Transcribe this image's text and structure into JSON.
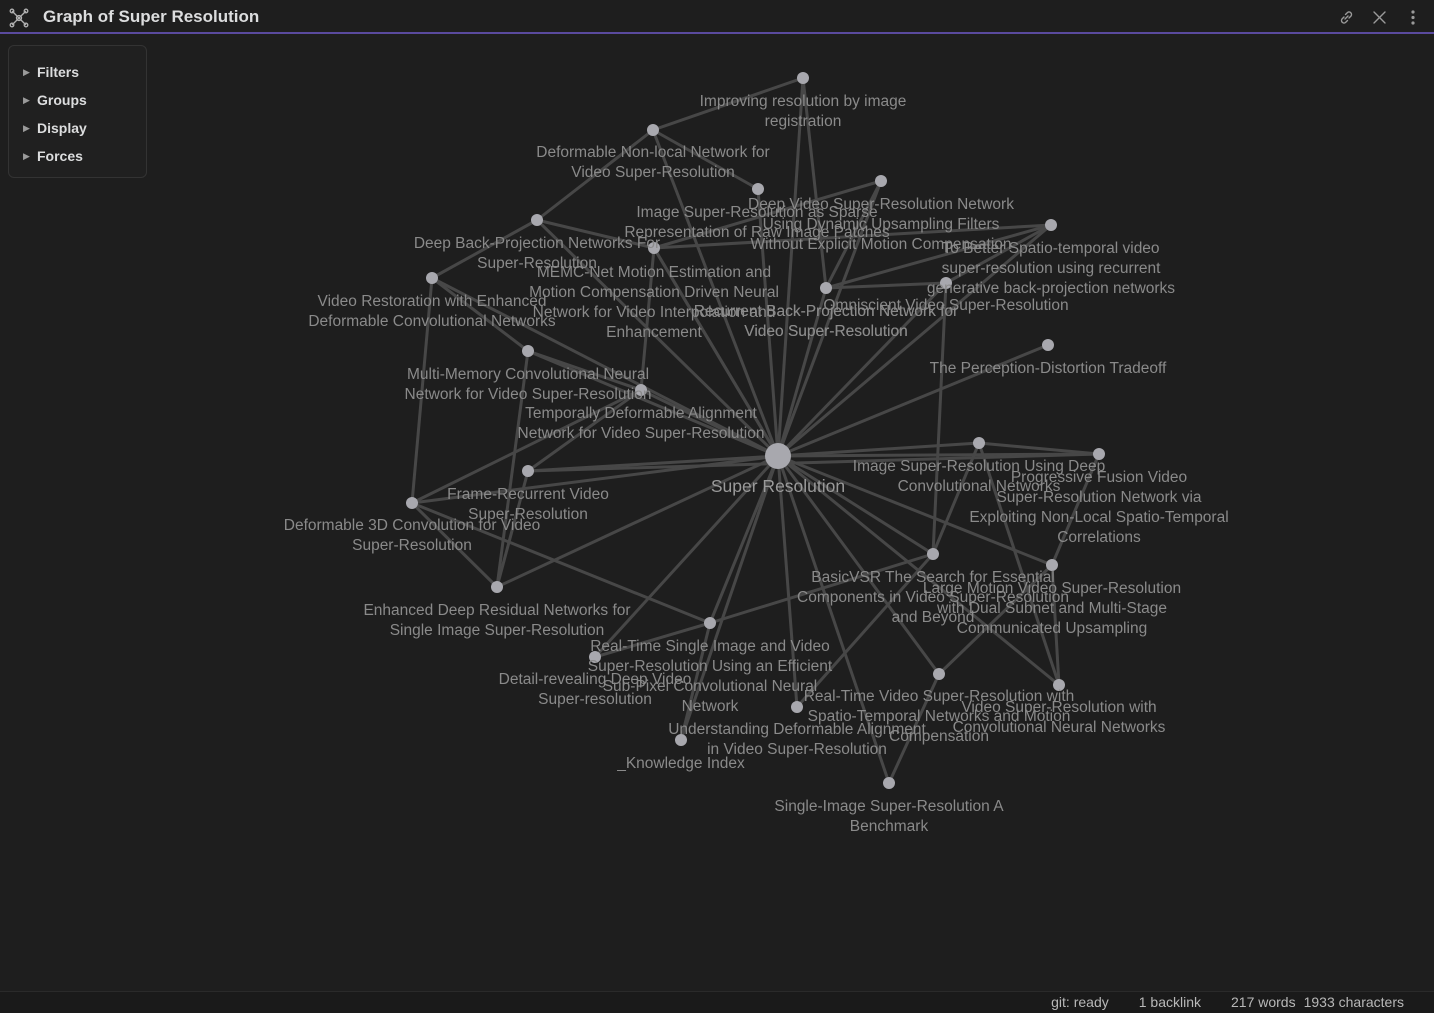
{
  "window": {
    "title": "Graph of Super Resolution",
    "icon": "graph-icon",
    "actions": [
      "link-icon",
      "close-icon",
      "more-vertical-icon"
    ]
  },
  "controls": {
    "items": [
      {
        "label": "Filters",
        "icon": "triangle-right-icon"
      },
      {
        "label": "Groups",
        "icon": "triangle-right-icon"
      },
      {
        "label": "Display",
        "icon": "triangle-right-icon"
      },
      {
        "label": "Forces",
        "icon": "triangle-right-icon"
      }
    ]
  },
  "graph": {
    "colors": {
      "node": "#a8a8ae",
      "edge": "#474747",
      "label": "#8a8a8a",
      "background": "#1e1e1e",
      "accent": "#5a4a9e"
    },
    "center_node": {
      "id": "sr",
      "label": "Super Resolution"
    },
    "nodes": [
      {
        "id": "sr",
        "lines": [
          "Super Resolution"
        ]
      },
      {
        "id": "imreg",
        "lines": [
          "Improving resolution by image",
          "registration"
        ]
      },
      {
        "id": "dnln",
        "lines": [
          "Deformable Non-local Network for",
          "Video Super-Resolution"
        ]
      },
      {
        "id": "sparse",
        "lines": [
          "Image Super-Resolution as Sparse",
          "Representation of Raw Image Patches"
        ]
      },
      {
        "id": "dufvsr",
        "lines": [
          "Deep Video Super-Resolution Network",
          "Using Dynamic Upsampling Filters",
          "Without Explicit Motion Compensation"
        ]
      },
      {
        "id": "dbpn",
        "lines": [
          "Deep Back-Projection Networks For",
          "Super-Resolution"
        ]
      },
      {
        "id": "rbpn2",
        "lines": [
          "Recurrent Back-Projection Network for",
          "Video Super-Resolution"
        ]
      },
      {
        "id": "memc",
        "lines": [
          "MEMC-Net Motion Estimation and",
          "Motion Compensation Driven Neural",
          "Network for Video Interpolation and",
          "Enhancement"
        ]
      },
      {
        "id": "rbpn",
        "lines": [
          "Recurrent Back-Projection Network for",
          "Video Super-Resolution"
        ]
      },
      {
        "id": "stvsr",
        "lines": [
          "To Better Spatio-temporal video",
          "super-resolution using recurrent",
          "generative back-projection networks"
        ]
      },
      {
        "id": "edvr",
        "lines": [
          "Video Restoration with Enhanced",
          "Deformable Convolutional Networks"
        ]
      },
      {
        "id": "omni",
        "lines": [
          "Omniscient Video Super-Resolution"
        ]
      },
      {
        "id": "perc",
        "lines": [
          "The Perception-Distortion Tradeoff"
        ]
      },
      {
        "id": "mmcnn",
        "lines": [
          "Multi-Memory Convolutional Neural",
          "Network for Video Super-Resolution"
        ]
      },
      {
        "id": "tdan",
        "lines": [
          "Temporally Deformable Alignment",
          "Network for Video Super-Resolution"
        ]
      },
      {
        "id": "srcnn",
        "lines": [
          "Image Super-Resolution Using Deep",
          "Convolutional Networks"
        ]
      },
      {
        "id": "pfnl",
        "lines": [
          "Progressive Fusion Video",
          "Super-Resolution Network via",
          "Exploiting Non-Local Spatio-Temporal",
          "Correlations"
        ]
      },
      {
        "id": "frvsr",
        "lines": [
          "Frame-Recurrent Video",
          "Super-Resolution"
        ]
      },
      {
        "id": "d3d",
        "lines": [
          "Deformable 3D Convolution for Video",
          "Super-Resolution"
        ]
      },
      {
        "id": "basicvsr",
        "lines": [
          "BasicVSR The Search for Essential",
          "Components in Video Super-Resolution",
          "and Beyond"
        ]
      },
      {
        "id": "lmvsr",
        "lines": [
          "Large Motion Video Super-Resolution",
          "with Dual Subnet and Multi-Stage",
          "Communicated Upsampling"
        ]
      },
      {
        "id": "edsr",
        "lines": [
          "Enhanced Deep Residual Networks for",
          "Single Image Super-Resolution"
        ]
      },
      {
        "id": "espcn",
        "lines": [
          "Real-Time Single Image and Video",
          "Super-Resolution Using an Efficient",
          "Sub-Pixel Convolutional Neural",
          "Network"
        ]
      },
      {
        "id": "detail",
        "lines": [
          "Detail-revealing Deep Video",
          "Super-resolution"
        ]
      },
      {
        "id": "vespcn",
        "lines": [
          "Real-Time Video Super-Resolution with",
          "Spatio-Temporal Networks and Motion",
          "Compensation"
        ]
      },
      {
        "id": "vsrcnn",
        "lines": [
          "Video Super-Resolution with",
          "Convolutional Neural Networks"
        ]
      },
      {
        "id": "understand",
        "lines": [
          "Understanding Deformable Alignment",
          "in Video Super-Resolution"
        ]
      },
      {
        "id": "kindex",
        "lines": [
          "_Knowledge Index"
        ]
      },
      {
        "id": "benchmark",
        "lines": [
          "Single-Image Super-Resolution A",
          "Benchmark"
        ]
      }
    ],
    "edges": [
      [
        "sr",
        "imreg"
      ],
      [
        "sr",
        "dnln"
      ],
      [
        "sr",
        "sparse"
      ],
      [
        "sr",
        "dufvsr"
      ],
      [
        "sr",
        "dbpn"
      ],
      [
        "sr",
        "rbpn2"
      ],
      [
        "sr",
        "memc"
      ],
      [
        "sr",
        "rbpn"
      ],
      [
        "sr",
        "stvsr"
      ],
      [
        "sr",
        "edvr"
      ],
      [
        "sr",
        "omni"
      ],
      [
        "sr",
        "perc"
      ],
      [
        "sr",
        "mmcnn"
      ],
      [
        "sr",
        "tdan"
      ],
      [
        "sr",
        "srcnn"
      ],
      [
        "sr",
        "pfnl"
      ],
      [
        "sr",
        "frvsr"
      ],
      [
        "sr",
        "d3d"
      ],
      [
        "sr",
        "basicvsr"
      ],
      [
        "sr",
        "lmvsr"
      ],
      [
        "sr",
        "edsr"
      ],
      [
        "sr",
        "espcn"
      ],
      [
        "sr",
        "detail"
      ],
      [
        "sr",
        "vespcn"
      ],
      [
        "sr",
        "vsrcnn"
      ],
      [
        "sr",
        "understand"
      ],
      [
        "sr",
        "kindex"
      ],
      [
        "sr",
        "benchmark"
      ],
      [
        "dnln",
        "imreg"
      ],
      [
        "dnln",
        "dbpn"
      ],
      [
        "dnln",
        "sparse"
      ],
      [
        "dbpn",
        "memc"
      ],
      [
        "dbpn",
        "edvr"
      ],
      [
        "imreg",
        "rbpn"
      ],
      [
        "dufvsr",
        "rbpn"
      ],
      [
        "dufvsr",
        "rbpn2"
      ],
      [
        "rbpn",
        "stvsr"
      ],
      [
        "rbpn",
        "omni"
      ],
      [
        "stvsr",
        "memc"
      ],
      [
        "edvr",
        "d3d"
      ],
      [
        "edvr",
        "mmcnn"
      ],
      [
        "mmcnn",
        "tdan"
      ],
      [
        "mmcnn",
        "edsr"
      ],
      [
        "tdan",
        "frvsr"
      ],
      [
        "tdan",
        "d3d"
      ],
      [
        "memc",
        "tdan"
      ],
      [
        "frvsr",
        "pfnl"
      ],
      [
        "pfnl",
        "lmvsr"
      ],
      [
        "srcnn",
        "pfnl"
      ],
      [
        "srcnn",
        "basicvsr"
      ],
      [
        "basicvsr",
        "omni"
      ],
      [
        "basicvsr",
        "espcn"
      ],
      [
        "lmvsr",
        "vsrcnn"
      ],
      [
        "lmvsr",
        "vespcn"
      ],
      [
        "vespcn",
        "benchmark"
      ],
      [
        "detail",
        "espcn"
      ],
      [
        "espcn",
        "d3d"
      ],
      [
        "d3d",
        "edsr"
      ],
      [
        "kindex",
        "espcn"
      ],
      [
        "understand",
        "basicvsr"
      ],
      [
        "omni",
        "stvsr"
      ],
      [
        "vsrcnn",
        "srcnn"
      ],
      [
        "edsr",
        "frvsr"
      ]
    ]
  },
  "status": {
    "git": "git: ready",
    "backlinks": "1 backlink",
    "words": "217 words",
    "characters": "1933 characters"
  }
}
